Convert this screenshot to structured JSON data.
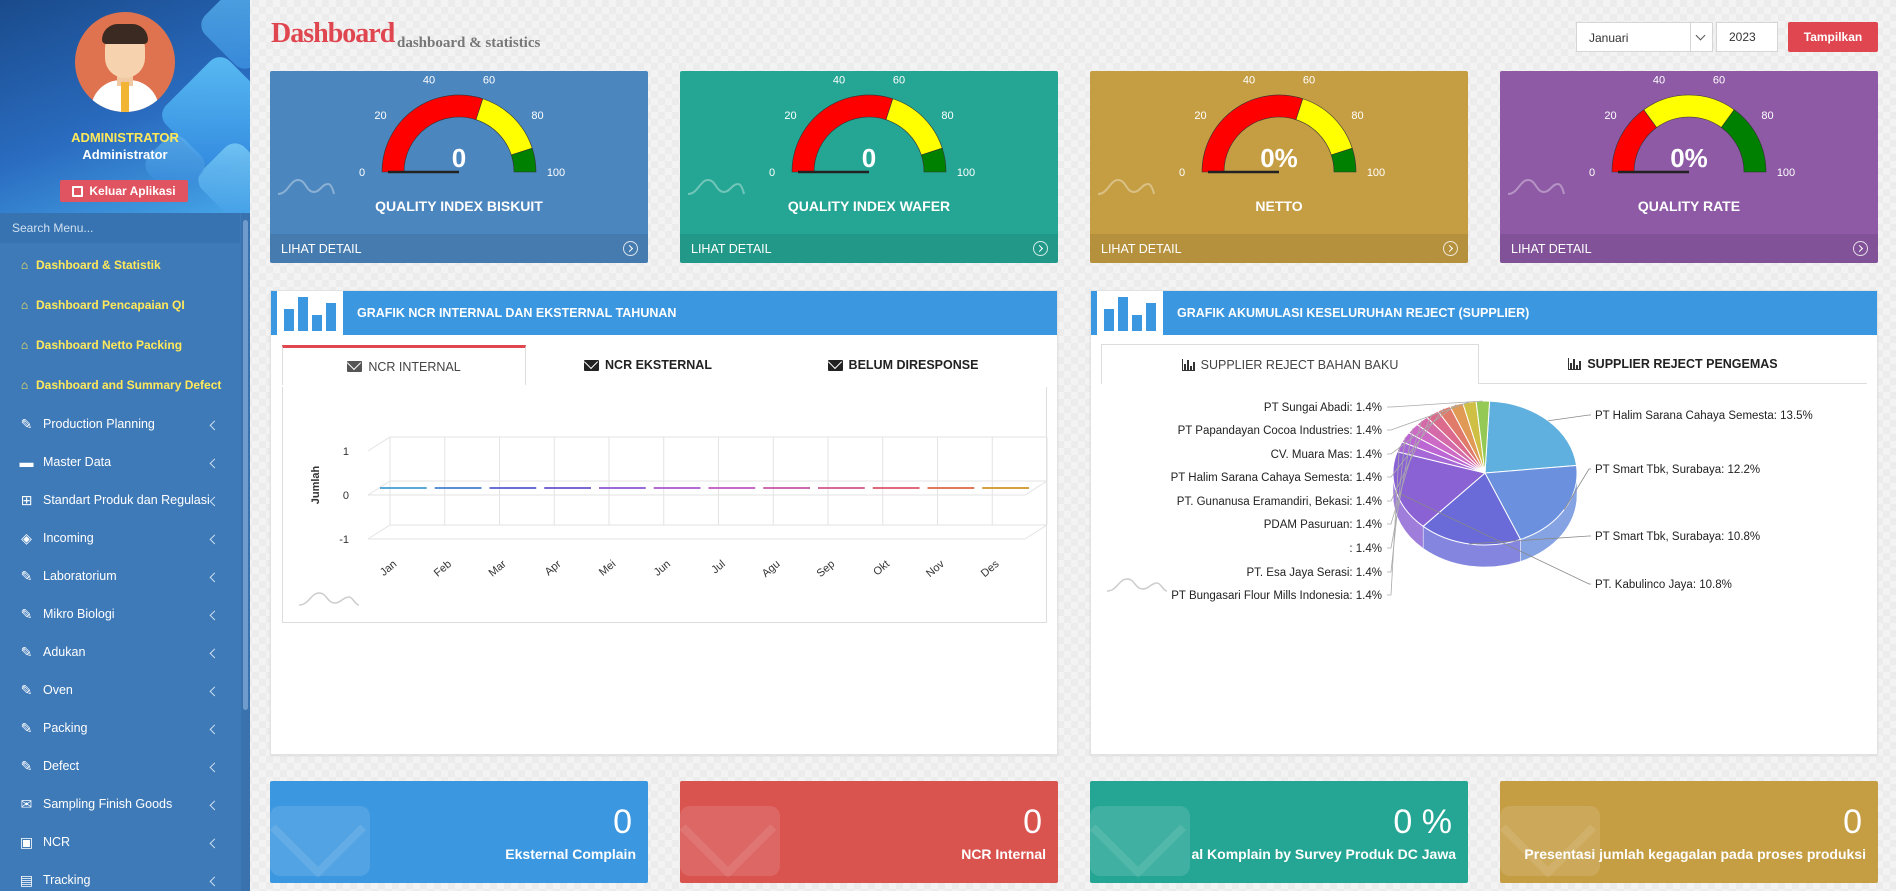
{
  "profile": {
    "role": "ADMINISTRATOR",
    "name": "Administrator",
    "logout_label": "Keluar Aplikasi"
  },
  "search": {
    "placeholder": "Search Menu..."
  },
  "menu": [
    {
      "label": "Dashboard & Statistik",
      "icon": "home-icon",
      "highlight": true
    },
    {
      "label": "Dashboard Pencapaian QI",
      "icon": "home-icon",
      "highlight": true
    },
    {
      "label": "Dashboard Netto Packing",
      "icon": "home-icon",
      "highlight": true
    },
    {
      "label": "Dashboard and Summary Defect",
      "icon": "home-icon",
      "highlight": true
    },
    {
      "label": "Production Planning",
      "icon": "edit-icon"
    },
    {
      "label": "Master Data",
      "icon": "folder-icon"
    },
    {
      "label": "Standart Produk dan Regulasi",
      "icon": "gift-icon"
    },
    {
      "label": "Incoming",
      "icon": "cube-icon"
    },
    {
      "label": "Laboratorium",
      "icon": "edit-icon"
    },
    {
      "label": "Mikro Biologi",
      "icon": "edit-icon"
    },
    {
      "label": "Adukan",
      "icon": "edit-icon"
    },
    {
      "label": "Oven",
      "icon": "edit-icon"
    },
    {
      "label": "Packing",
      "icon": "edit-icon"
    },
    {
      "label": "Defect",
      "icon": "edit-icon"
    },
    {
      "label": "Sampling Finish Goods",
      "icon": "envelope-icon"
    },
    {
      "label": "NCR",
      "icon": "inbox-icon"
    },
    {
      "label": "Tracking",
      "icon": "table-icon"
    }
  ],
  "header": {
    "title": "Dashboard",
    "subtitle": "dashboard & statistics",
    "month": "Januari",
    "year": "2023",
    "show_label": "Tampilkan"
  },
  "gauges": [
    {
      "name": "QUALITY INDEX BISKUIT",
      "value_text": "0",
      "value": 0,
      "color": "#4c86be",
      "footer": "LIHAT DETAIL",
      "bands": [
        "#ff0000",
        "#ffff00",
        "#008000"
      ],
      "band_limits": [
        60,
        90
      ]
    },
    {
      "name": "QUALITY INDEX WAFER",
      "value_text": "0",
      "value": 0,
      "color": "#25a694",
      "footer": "LIHAT DETAIL",
      "bands": [
        "#ff0000",
        "#ffff00",
        "#008000"
      ],
      "band_limits": [
        60,
        90
      ]
    },
    {
      "name": "NETTO",
      "value_text": "0%",
      "value": 0,
      "color": "#c59e44",
      "footer": "LIHAT DETAIL",
      "bands": [
        "#ff0000",
        "#ffff00",
        "#008000"
      ],
      "band_limits": [
        60,
        90
      ]
    },
    {
      "name": "QUALITY RATE",
      "value_text": "0%",
      "value": 0,
      "color": "#8e5aa5",
      "footer": "LIHAT DETAIL",
      "bands": [
        "#ff0000",
        "#ffff00",
        "#008000"
      ],
      "band_limits": [
        30,
        70
      ]
    }
  ],
  "gauge_ticks": [
    "0",
    "20",
    "40",
    "60",
    "80",
    "100"
  ],
  "ncr_panel": {
    "title": "GRAFIK NCR INTERNAL DAN EKSTERNAL TAHUNAN",
    "tabs": [
      "NCR INTERNAL",
      "NCR EKSTERNAL",
      "BELUM DIRESPONSE"
    ]
  },
  "reject_panel": {
    "title": "GRAFIK AKUMULASI KESELURUHAN REJECT (SUPPLIER)",
    "tabs": [
      "SUPPLIER REJECT BAHAN BAKU",
      "SUPPLIER REJECT PENGEMAS"
    ]
  },
  "stats": [
    {
      "value": "0",
      "label": "Eksternal Complain",
      "color": "#3b97e0"
    },
    {
      "value": "0",
      "label": "NCR Internal",
      "color": "#d9534f"
    },
    {
      "value": "0 %",
      "label": "al Komplain by Survey Produk DC Jawa",
      "color": "#25a694"
    },
    {
      "value": "0",
      "label": "Presentasi jumlah kegagalan pada proses produksi",
      "color": "#c59e44"
    }
  ],
  "chart_data": [
    {
      "type": "line",
      "categories": [
        "Jan",
        "Feb",
        "Mar",
        "Apr",
        "Mei",
        "Jun",
        "Jul",
        "Agu",
        "Sep",
        "Okt",
        "Nov",
        "Des"
      ],
      "values": [
        0,
        0,
        0,
        0,
        0,
        0,
        0,
        0,
        0,
        0,
        0,
        0
      ],
      "colors": [
        "#5aa9d9",
        "#5b8fd6",
        "#6a6fd8",
        "#7a68d4",
        "#9a6ad6",
        "#b46ad4",
        "#c86ac8",
        "#d06ab0",
        "#d86a9a",
        "#e06a7a",
        "#e07a5a",
        "#d4a040"
      ],
      "ylabel": "Jumlah",
      "yticks": [
        "1",
        "0",
        "-1"
      ],
      "ylim": [
        -1,
        1
      ]
    },
    {
      "type": "pie",
      "labels": [
        "PT Halim Sarana Cahaya Semesta",
        "PT Smart Tbk, Surabaya",
        "PT Smart Tbk, Surabaya",
        "PT. Kabulinco Jaya",
        "PT Bungasari Flour Mills Indonesia",
        "PT. Esa Jaya Serasi",
        "",
        "PDAM Pasuruan",
        "PT. Gunanusa Eramandiri, Bekasi",
        "PT Halim Sarana Cahaya Semesta",
        "CV. Muara Mas",
        "PT Papandayan Cocoa Industries",
        "PT Sungai Abadi"
      ],
      "values": [
        13.5,
        12.2,
        10.8,
        10.8,
        1.4,
        1.4,
        1.4,
        1.4,
        1.4,
        1.4,
        1.4,
        1.4,
        1.4
      ],
      "display": [
        "13.5%",
        "12.2%",
        "10.8%",
        "10.8%",
        "1.4%",
        "1.4%",
        "1.4%",
        "1.4%",
        "1.4%",
        "1.4%",
        "1.4%",
        "1.4%",
        "1.4%"
      ]
    }
  ]
}
